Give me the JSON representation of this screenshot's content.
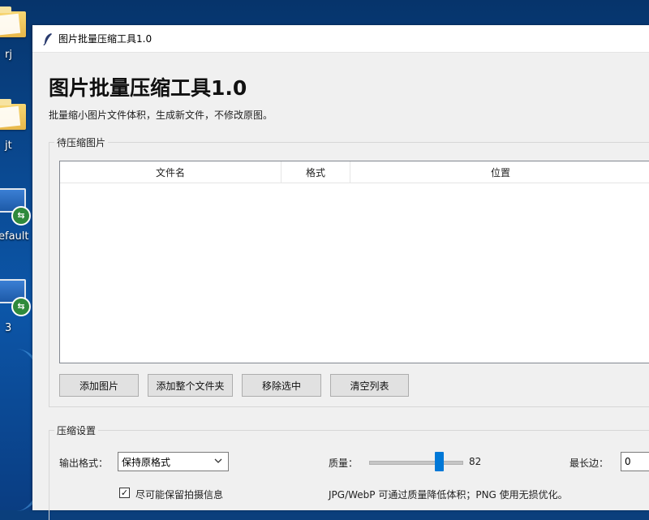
{
  "desktop": {
    "icons": [
      {
        "label": "rj",
        "kind": "folder"
      },
      {
        "label": "jt",
        "kind": "folder"
      },
      {
        "label": "efault",
        "kind": "remote-desktop"
      },
      {
        "label": "3",
        "kind": "remote-desktop"
      }
    ]
  },
  "window": {
    "title": "图片批量压缩工具1.0",
    "icon": "feather-icon"
  },
  "header": {
    "title": "图片批量压缩工具1.0",
    "subtitle": "批量缩小图片文件体积，生成新文件，不修改原图。"
  },
  "images_group": {
    "title": "待压缩图片",
    "columns": [
      "文件名",
      "格式",
      "位置"
    ],
    "rows": [],
    "buttons": {
      "add_images": "添加图片",
      "add_folder": "添加整个文件夹",
      "remove_selected": "移除选中",
      "clear_list": "清空列表"
    }
  },
  "settings_group": {
    "title": "压缩设置",
    "output_format_label": "输出格式：",
    "output_format_value": "保持原格式",
    "quality_label": "质量：",
    "quality_value": "82",
    "quality_level": 82,
    "max_side_label": "最长边：",
    "max_side_value": "0",
    "keep_exif_checked": true,
    "keep_exif_label": "尽可能保留拍摄信息",
    "hint": "JPG/WebP 可通过质量降低体积；PNG 使用无损优化。"
  },
  "colors": {
    "accent": "#0078d7",
    "window_bg": "#f0f0f0",
    "desktop": "#0a4a93"
  }
}
